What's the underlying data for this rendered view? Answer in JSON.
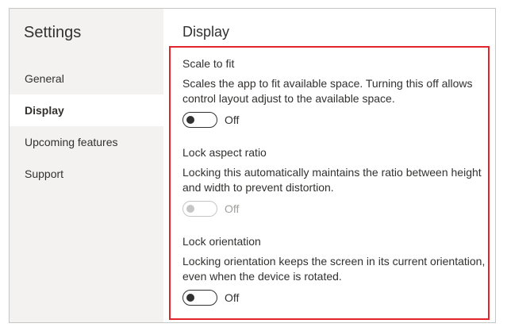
{
  "sidebar": {
    "title": "Settings",
    "items": [
      {
        "label": "General",
        "active": false
      },
      {
        "label": "Display",
        "active": true
      },
      {
        "label": "Upcoming features",
        "active": false
      },
      {
        "label": "Support",
        "active": false
      }
    ]
  },
  "main": {
    "title": "Display",
    "settings": [
      {
        "title": "Scale to fit",
        "description": "Scales the app to fit available space. Turning this off allows control layout adjust to the available space.",
        "toggle_state": "Off",
        "enabled": true
      },
      {
        "title": "Lock aspect ratio",
        "description": "Locking this automatically maintains the ratio between height and width to prevent distortion.",
        "toggle_state": "Off",
        "enabled": false
      },
      {
        "title": "Lock orientation",
        "description": "Locking orientation keeps the screen in its current orientation, even when the device is rotated.",
        "toggle_state": "Off",
        "enabled": true
      }
    ]
  },
  "colors": {
    "highlight_border": "#e3242b",
    "sidebar_bg": "#f3f2f1",
    "text": "#323130",
    "disabled": "#c8c6c4"
  }
}
